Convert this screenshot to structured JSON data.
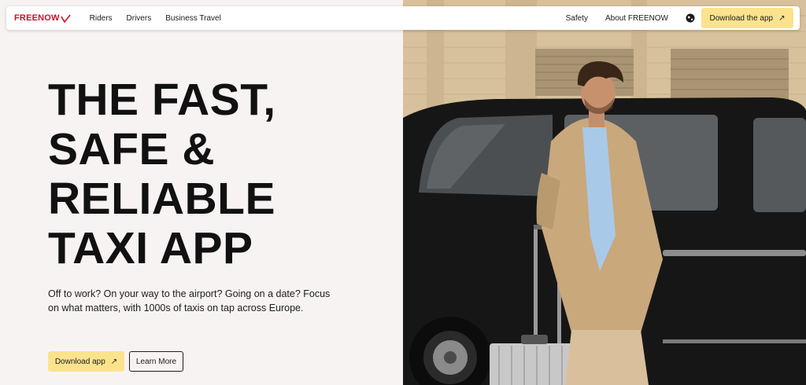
{
  "nav": {
    "logo_text": "FREENOW",
    "links": [
      "Riders",
      "Drivers",
      "Business Travel"
    ],
    "right_links": [
      "Safety",
      "About FREENOW"
    ],
    "globe_icon": "globe-icon",
    "cta_label": "Download the app",
    "cta_arrow": "↗"
  },
  "hero": {
    "headline_lines": [
      "THE FAST,",
      "SAFE &",
      "RELIABLE",
      "TAXI APP"
    ],
    "subtext": "Off to work? On your way to the airport? Going on a date? Focus on what matters, with 1000s of taxis on tap across Europe.",
    "primary_button": "Download app",
    "primary_arrow": "↗",
    "secondary_button": "Learn More"
  },
  "colors": {
    "brand_red": "#c8102e",
    "accent_yellow": "#fbe38e",
    "background": "#f8f3f3"
  }
}
